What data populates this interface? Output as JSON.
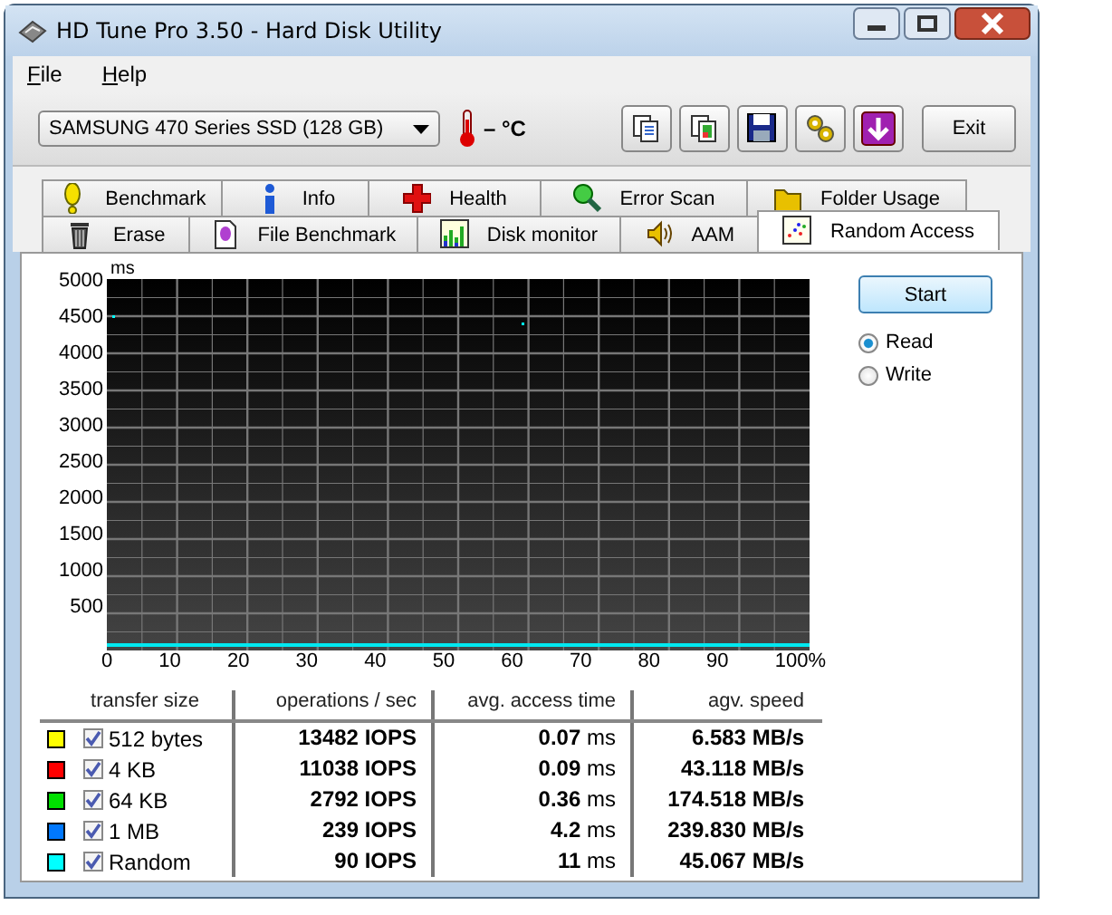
{
  "window": {
    "title": "HD Tune Pro 3.50 - Hard Disk Utility"
  },
  "menu": [
    {
      "label": "File"
    },
    {
      "label": "Help"
    }
  ],
  "toolbar": {
    "drive": "SAMSUNG 470 Series SSD (128 GB)",
    "temperature": "– °C",
    "icon_buttons": [
      {
        "kind": "copy"
      },
      {
        "kind": "copy-color"
      },
      {
        "kind": "save"
      },
      {
        "kind": "options"
      },
      {
        "kind": "download"
      }
    ],
    "exit": "Exit"
  },
  "tab_rows": [
    [
      {
        "label": "Benchmark",
        "kind": "exclamation",
        "selected": false
      },
      {
        "label": "Info",
        "kind": "info",
        "selected": false
      },
      {
        "label": "Health",
        "kind": "cross",
        "selected": false
      },
      {
        "label": "Error Scan",
        "kind": "magnifier",
        "selected": false
      },
      {
        "label": "Folder Usage",
        "kind": "folder",
        "selected": false
      }
    ],
    [
      {
        "label": "Erase",
        "kind": "trash",
        "selected": false
      },
      {
        "label": "File Benchmark",
        "kind": "file",
        "selected": false
      },
      {
        "label": "Disk monitor",
        "kind": "bars",
        "selected": false
      },
      {
        "label": "AAM",
        "kind": "speaker",
        "selected": false
      },
      {
        "label": "Random Access",
        "kind": "scatter",
        "selected": true
      }
    ]
  ],
  "chart": {
    "unit": "ms",
    "y_ticks": [
      "5000",
      "4500",
      "4000",
      "3500",
      "3000",
      "2500",
      "2000",
      "1500",
      "1000",
      "500"
    ],
    "x_ticks": [
      "0",
      "10",
      "20",
      "30",
      "40",
      "50",
      "60",
      "70",
      "80",
      "90",
      "100%"
    ]
  },
  "start_button": "Start",
  "mode": [
    {
      "label": "Read",
      "selected": true
    },
    {
      "label": "Write",
      "selected": false
    }
  ],
  "table": {
    "columns": [
      "transfer size",
      "operations / sec",
      "avg. access time",
      "agv. speed"
    ],
    "rows": [
      {
        "color": "#ffff00",
        "checked": true,
        "size": "512 bytes",
        "ops": "13482 IOPS",
        "access": "**0.07** ms",
        "speed": "6.583 MB/s"
      },
      {
        "color": "#ff0000",
        "checked": true,
        "size": "4 KB",
        "ops": "11038 IOPS",
        "access": "**0.09** ms",
        "speed": "43.118 MB/s"
      },
      {
        "color": "#00e000",
        "checked": true,
        "size": "64 KB",
        "ops": "2792 IOPS",
        "access": "**0.36** ms",
        "speed": "174.518 MB/s"
      },
      {
        "color": "#0078ff",
        "checked": true,
        "size": "1 MB",
        "ops": "239 IOPS",
        "access": "**4.2** ms",
        "speed": "239.830 MB/s"
      },
      {
        "color": "#00ffff",
        "checked": true,
        "size": "Random",
        "ops": "90 IOPS",
        "access": "**11** ms",
        "speed": "45.067 MB/s"
      }
    ]
  }
}
